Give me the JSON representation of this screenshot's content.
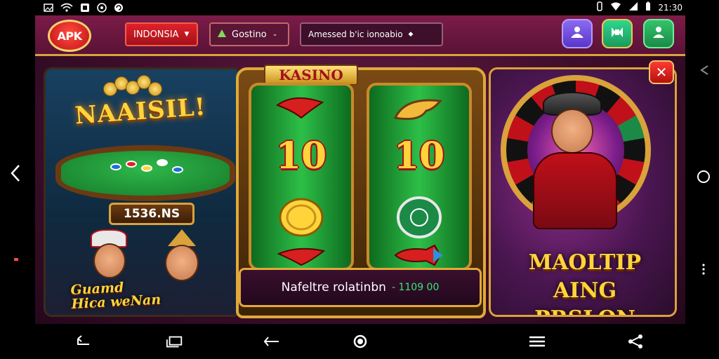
{
  "status_bar": {
    "time": "21:30"
  },
  "header": {
    "logo": "APK",
    "country": "INDONSIA",
    "game_select": "Gostino",
    "search": "Amessed b'ic ionoabio"
  },
  "panel_left": {
    "title": "NAAISIL!",
    "price": "1536.NS",
    "caption_line1": "Guamd",
    "caption_line2": "Hica weNan"
  },
  "slot": {
    "sign": "KASINO",
    "reel1_value": "10",
    "reel2_value": "10",
    "status_label": "Nafeltre rolatinbn",
    "status_value": "- 1109 00"
  },
  "panel_right": {
    "close_label": "✕",
    "promo_line1": "MAOLTIP AING",
    "promo_line2": "PRSLON"
  },
  "colors": {
    "header_bg": "#7b1c48",
    "accent_gold": "#d9a23b",
    "country_red": "#e0212a",
    "status_green": "#38e87a"
  }
}
